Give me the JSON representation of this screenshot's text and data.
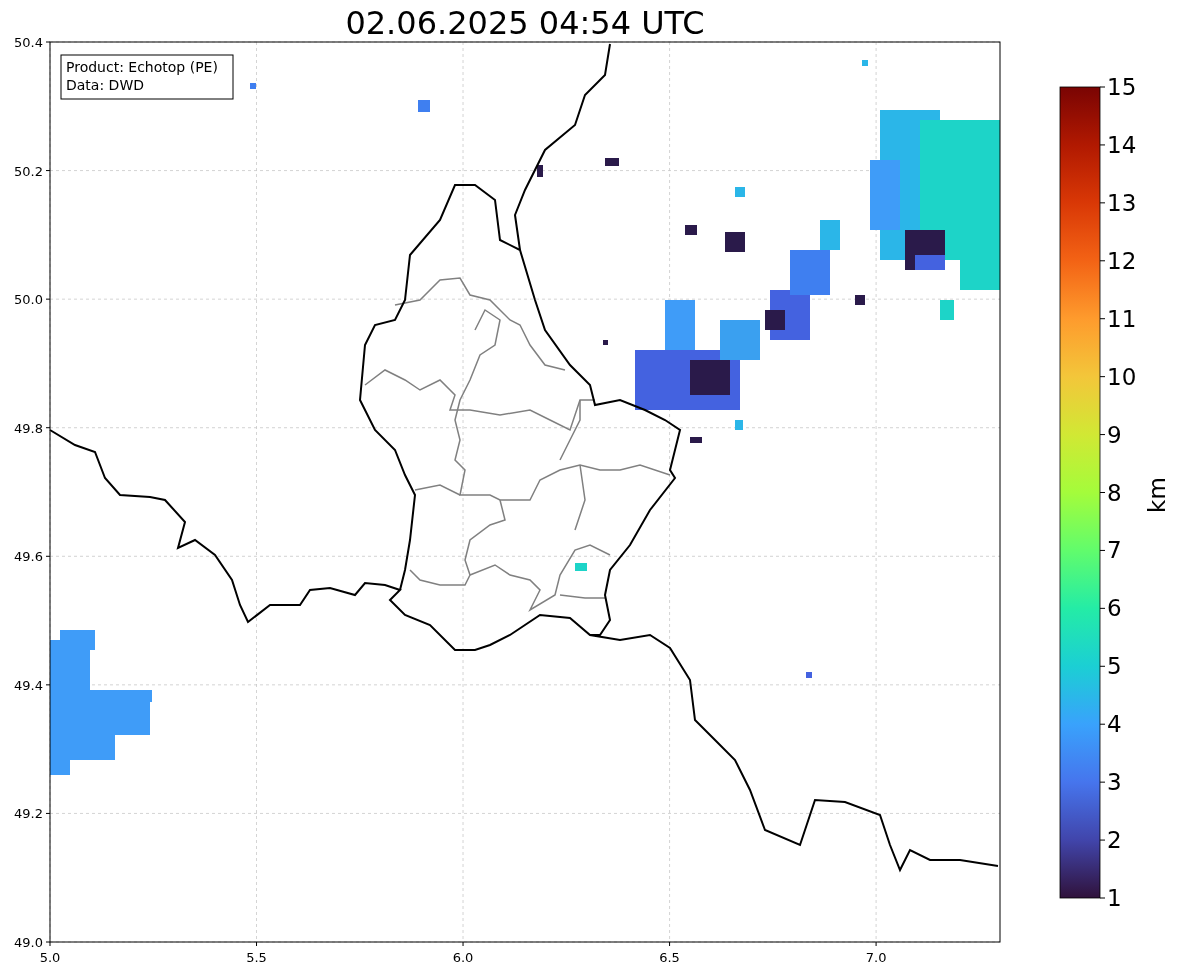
{
  "title": "02.06.2025 04:54 UTC",
  "legend": {
    "lines": [
      "Product: Echotop (PE)",
      "Data: DWD"
    ]
  },
  "x_axis": {
    "ticks": [
      "5.0",
      "5.5",
      "6.0",
      "6.5",
      "7.0"
    ]
  },
  "y_axis": {
    "ticks": [
      "50.4",
      "50.2",
      "50.0",
      "49.8",
      "49.6",
      "49.4",
      "49.2",
      "49.0"
    ]
  },
  "colorbar": {
    "label": "km",
    "ticks": [
      "15",
      "14",
      "13",
      "12",
      "11",
      "10",
      "9",
      "8",
      "7",
      "6",
      "5",
      "4",
      "3",
      "2",
      "1"
    ]
  }
}
